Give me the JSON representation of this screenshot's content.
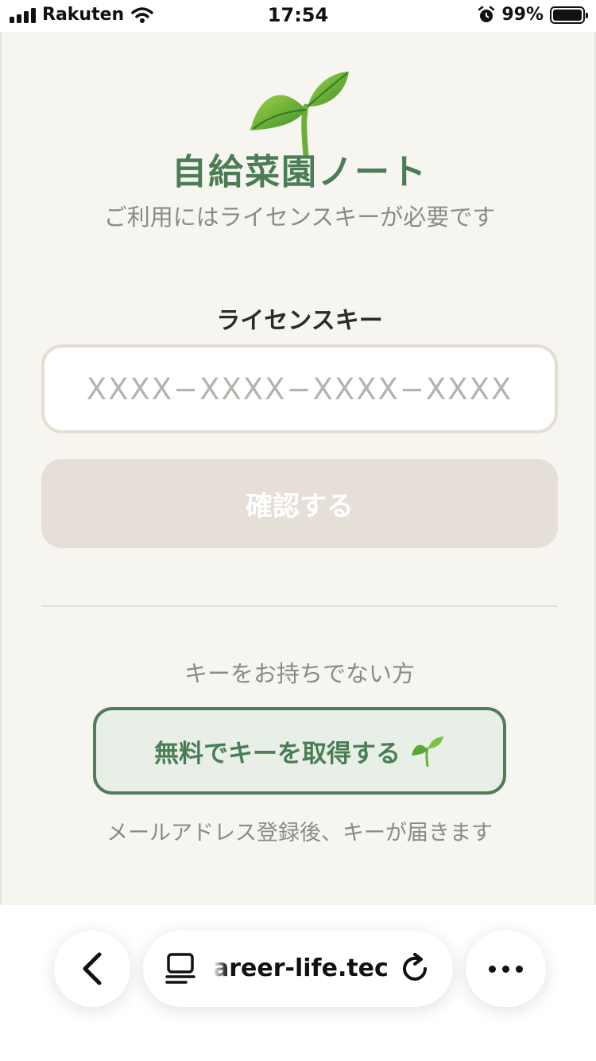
{
  "status_bar": {
    "carrier": "Rakuten",
    "time": "17:54",
    "battery_percent": "99%",
    "battery_level": 0.99,
    "icons": [
      "signal-icon",
      "wifi-icon",
      "alarm-icon",
      "battery-icon"
    ]
  },
  "app": {
    "title": "自給菜園ノート",
    "subtitle": "ご利用にはライセンスキーが必要です",
    "logo_icon": "sprout-icon"
  },
  "license": {
    "label": "ライセンスキー",
    "placeholder": "XXXX−XXXX−XXXX−XXXX",
    "value": ""
  },
  "confirm_button": {
    "label": "確認する",
    "enabled": false
  },
  "get_key": {
    "prompt": "キーをお持ちでない方",
    "button_label": "無料でキーを取得する",
    "note": "メールアドレス登録後、キーが届きます"
  },
  "browser": {
    "url": "areer-life.tech",
    "icons": [
      "back-icon",
      "tab-icon",
      "reload-icon",
      "more-icon"
    ]
  },
  "colors": {
    "accent_green": "#4a7d56",
    "background": "#f6f5f0",
    "disabled_button": "#e5dfd8",
    "get_key_bg": "#e7efe6"
  }
}
